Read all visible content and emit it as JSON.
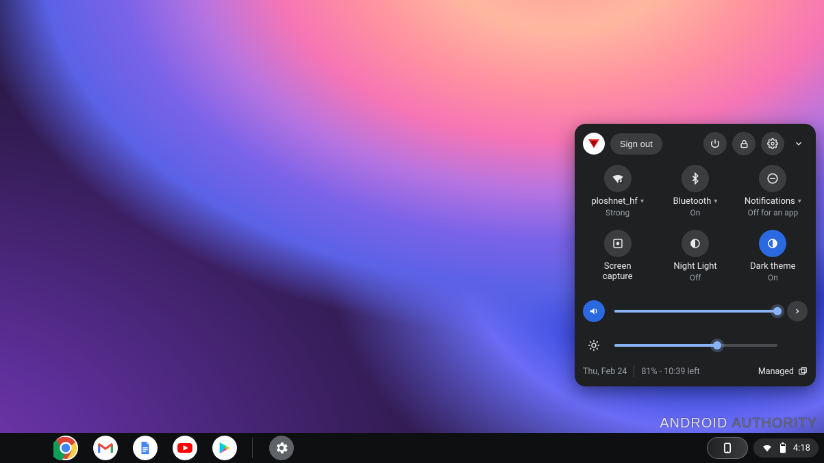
{
  "quick_settings": {
    "sign_out": "Sign out",
    "tiles": {
      "wifi": {
        "label": "ploshnet_hf",
        "sub": "Strong",
        "has_arrow": true,
        "active": false
      },
      "bluetooth": {
        "label": "Bluetooth",
        "sub": "On",
        "has_arrow": true,
        "active": false
      },
      "notifications": {
        "label": "Notifications",
        "sub": "Off for an app",
        "has_arrow": true,
        "active": false
      },
      "screen_capture": {
        "label": "Screen",
        "label2": "capture",
        "active": false
      },
      "night_light": {
        "label": "Night Light",
        "sub": "Off",
        "active": false
      },
      "dark_theme": {
        "label": "Dark theme",
        "sub": "On",
        "active": true
      }
    },
    "volume_percent": 100,
    "brightness_percent": 63,
    "footer": {
      "date": "Thu, Feb 24",
      "battery": "81% - 10:39 left",
      "managed": "Managed"
    }
  },
  "status": {
    "time": "4:18"
  },
  "shelf": {
    "apps": [
      "chrome",
      "gmail",
      "docs",
      "youtube",
      "play-store",
      "settings"
    ]
  },
  "watermark": {
    "a": "ANDROID",
    "b": "AUTHORITY"
  }
}
